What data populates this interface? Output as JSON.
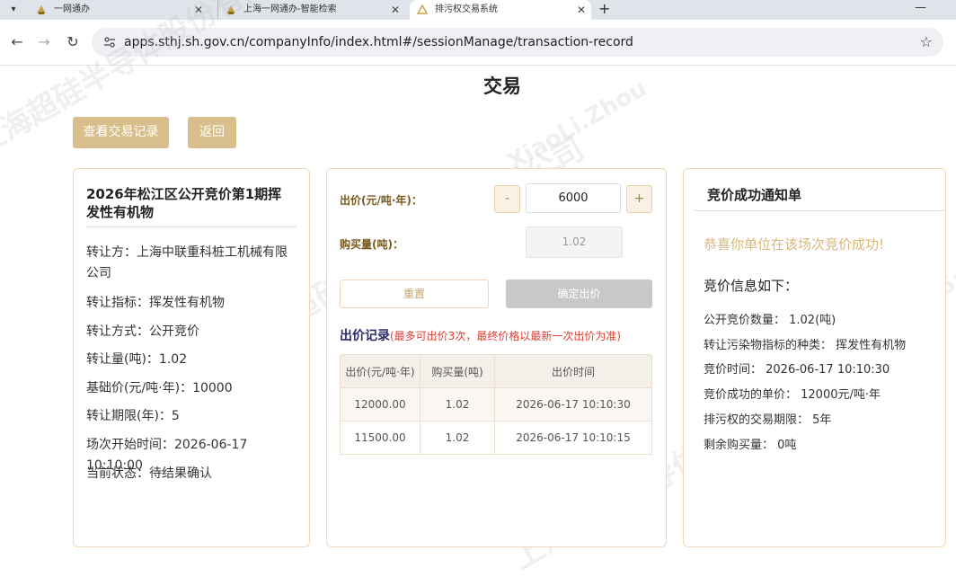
{
  "browser": {
    "tabs": [
      {
        "title": "一网通办",
        "active": false
      },
      {
        "title": "上海一网通办-智能检索",
        "active": false
      },
      {
        "title": "排污权交易系统",
        "active": true
      }
    ],
    "url": "apps.sthj.sh.gov.cn/companyInfo/index.html#/sessionManage/transaction-record",
    "icons": [
      "tab-dropdown-icon",
      "close-icon",
      "new-tab-icon",
      "minimize-icon",
      "back-icon",
      "forward-icon",
      "reload-icon",
      "site-info-icon",
      "bookmark-star-icon"
    ]
  },
  "page": {
    "title": "交易",
    "view_records_label": "查看交易记录",
    "back_label": "返回"
  },
  "lot": {
    "title": "2026年松江区公开竞价第1期挥发性有机物",
    "rows": [
      "转让方：上海中联重科桩工机械有限公司",
      "转让指标：挥发性有机物",
      "转让方式：公开竞价",
      "转让量(吨)：1.02",
      "基础价(元/吨·年)：10000",
      "转让期限(年)：5",
      "场次开始时间：2026-06-17 10:10:00",
      "当前状态：待结果确认"
    ]
  },
  "bid": {
    "price_label": "出价(元/吨·年)：",
    "minus": "-",
    "plus": "+",
    "price_value": "6000",
    "qty_label": "购买量(吨)：",
    "qty_value": "1.02",
    "reset_label": "重置",
    "confirm_label": "确定出价",
    "record_title": "出价记录",
    "record_note": "(最多可出价3次，最终价格以最新一次出价为准)",
    "columns": [
      "出价(元/吨·年)",
      "购买量(吨)",
      "出价时间"
    ],
    "records": [
      [
        "12000.00",
        "1.02",
        "2026-06-17 10:10:30"
      ],
      [
        "11500.00",
        "1.02",
        "2026-06-17 10:10:15"
      ]
    ]
  },
  "notice": {
    "title": "竞价成功通知单",
    "congrats": "恭喜你单位在该场次竞价成功!",
    "subtitle": "竞价信息如下：",
    "rows": [
      "公开竞价数量：   1.02(吨)",
      "转让污染物指标的种类：   挥发性有机物",
      "竞价时间：   2026-06-17 10:10:30",
      "竞价成功的单价：   12000元/吨·年",
      "排污权的交易期限：   5年",
      "剩余购买量：   0吨"
    ]
  },
  "watermark": {
    "company": "上海超硅半导体股份有限公司",
    "user": "XiaoLi.Zhou",
    "time": "2026-06-17 10:16:22"
  },
  "colors": {
    "accent_gold": "#d9bf8b",
    "card_border": "#efd8b7",
    "congrats_text": "#d9b77c",
    "note_red": "#e23b2f",
    "record_title_navy": "#2b2b6a"
  }
}
